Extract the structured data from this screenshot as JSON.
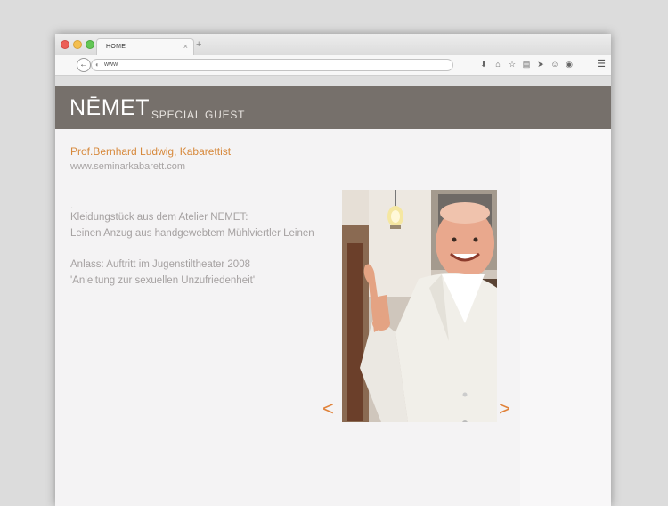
{
  "browser": {
    "tab_label": "HOME",
    "tab_close": "×",
    "new_tab": "+",
    "url": "www",
    "back_icon": "arrow-left",
    "toolbar_icons": [
      "download-icon",
      "home-icon",
      "star-icon",
      "clipboard-icon",
      "send-icon",
      "smiley-icon",
      "chat-icon"
    ],
    "menu_icon": "hamburger-menu"
  },
  "banner": {
    "logo": "NĒMET",
    "tagline": "SPECIAL GUEST",
    "background_color": "#76706b"
  },
  "guest": {
    "name": "Prof.Bernhard Ludwig, Kabarettist",
    "website": "www.seminarkabarett.com",
    "dot": ".",
    "lines": [
      "Kleidungstück aus dem Atelier NEMET:",
      "Leinen Anzug aus handgewebtem Mühlviertler Leinen",
      "Anlass: Auftritt im Jugenstiltheater 2008",
      "'Anleitung zur sexuellen Unzufriedenheit'"
    ],
    "accent_color": "#d7893c"
  },
  "gallery": {
    "prev": "<",
    "next": ">"
  }
}
